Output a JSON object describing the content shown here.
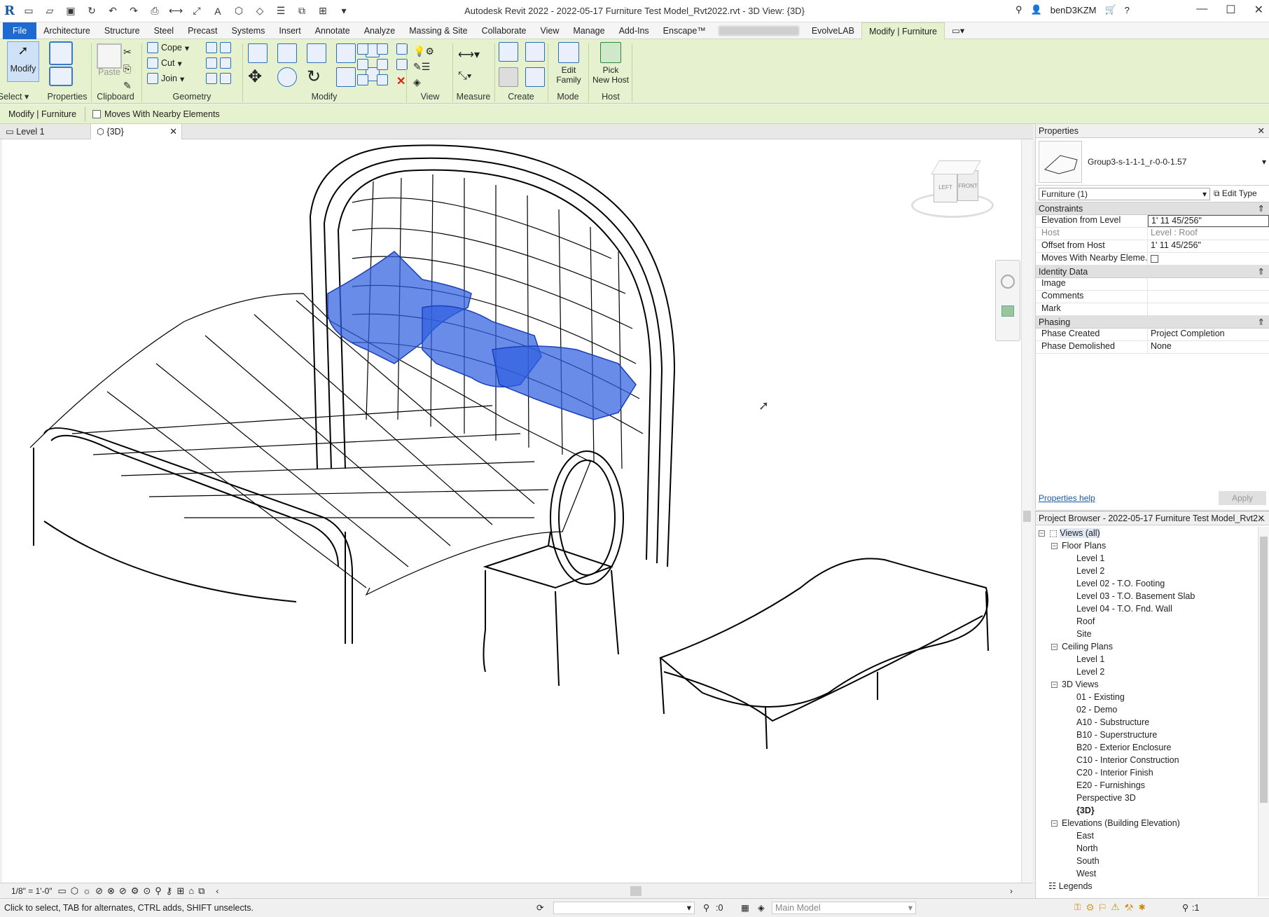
{
  "app": {
    "title": "Autodesk Revit 2022 - 2022-05-17 Furniture Test Model_Rvt2022.rvt - 3D View: {3D}",
    "user": "benD3KZM"
  },
  "ribbon_tabs": [
    "File",
    "Architecture",
    "Structure",
    "Steel",
    "Precast",
    "Systems",
    "Insert",
    "Annotate",
    "Analyze",
    "Massing & Site",
    "Collaborate",
    "View",
    "Manage",
    "Add-Ins",
    "Enscape™",
    "EvolveLAB",
    "Modify | Furniture"
  ],
  "ribbon": {
    "select": {
      "modify": "Modify",
      "select": "Select",
      "properties": "Properties"
    },
    "clipboard": {
      "paste": "Paste",
      "label": "Clipboard"
    },
    "geometry": {
      "cope": "Cope",
      "cut": "Cut",
      "join": "Join",
      "label": "Geometry"
    },
    "modify_label": "Modify",
    "view_label": "View",
    "measure_label": "Measure",
    "create_label": "Create",
    "mode": {
      "edit_family_1": "Edit",
      "edit_family_2": "Family",
      "label": "Mode"
    },
    "host": {
      "pick_1": "Pick",
      "pick_2": "New Host",
      "label": "Host"
    }
  },
  "context": {
    "label": "Modify | Furniture",
    "checkbox": "Moves With Nearby Elements"
  },
  "view_tabs": [
    "Level 1",
    "{3D}"
  ],
  "viewcube": {
    "left": "LEFT",
    "front": "FRONT"
  },
  "viewbar": {
    "scale": "1/8\" = 1'-0\""
  },
  "status": {
    "hint": "Click to select, TAB for alternates, CTRL adds, SHIFT unselects.",
    "filter_count": ":0",
    "model": "Main Model",
    "sel_count": ":1"
  },
  "properties": {
    "title": "Properties",
    "type_name": "Group3-s-1-1-1_r-0-0-1.57",
    "instance": "Furniture (1)",
    "edit_type": "Edit Type",
    "sections": [
      {
        "name": "Constraints",
        "rows": [
          {
            "k": "Elevation from Level",
            "v": "1'  11 45/256\""
          },
          {
            "k": "Host",
            "v": "Level : Roof"
          },
          {
            "k": "Offset from Host",
            "v": "1'  11 45/256\""
          },
          {
            "k": "Moves With Nearby Eleme...",
            "v": ""
          }
        ]
      },
      {
        "name": "Identity Data",
        "rows": [
          {
            "k": "Image",
            "v": ""
          },
          {
            "k": "Comments",
            "v": ""
          },
          {
            "k": "Mark",
            "v": ""
          }
        ]
      },
      {
        "name": "Phasing",
        "rows": [
          {
            "k": "Phase Created",
            "v": "Project Completion"
          },
          {
            "k": "Phase Demolished",
            "v": "None"
          }
        ]
      }
    ],
    "help": "Properties help",
    "apply": "Apply"
  },
  "browser": {
    "title": "Project Browser - 2022-05-17 Furniture Test Model_Rvt2...",
    "root": "Views (all)",
    "groups": [
      {
        "name": "Floor Plans",
        "items": [
          "Level 1",
          "Level 2",
          "Level 02 - T.O. Footing",
          "Level 03 - T.O. Basement Slab",
          "Level 04 - T.O. Fnd. Wall",
          "Roof",
          "Site"
        ]
      },
      {
        "name": "Ceiling Plans",
        "items": [
          "Level 1",
          "Level 2"
        ]
      },
      {
        "name": "3D Views",
        "items": [
          "01 - Existing",
          "02 - Demo",
          "A10 - Substructure",
          "B10 - Superstructure",
          "B20 - Exterior Enclosure",
          "C10 - Interior Construction",
          "C20 - Interior Finish",
          "E20 - Furnishings",
          "Perspective 3D",
          "{3D}"
        ]
      },
      {
        "name": "Elevations (Building Elevation)",
        "items": [
          "East",
          "North",
          "South",
          "West"
        ]
      }
    ],
    "legends": "Legends"
  },
  "colors": {
    "accent": "#1f6ad1",
    "ribbon": "#e6f1cf",
    "selection": "#2f5fe0"
  }
}
